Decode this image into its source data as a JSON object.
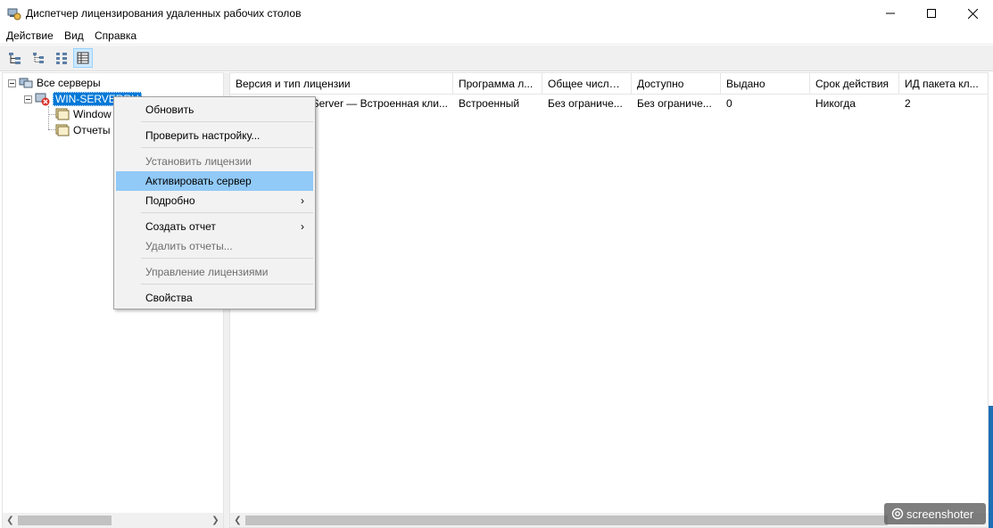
{
  "window": {
    "title": "Диспетчер лицензирования удаленных рабочих столов",
    "icon": "license-manager-icon"
  },
  "menu": {
    "items": [
      "Действие",
      "Вид",
      "Справка"
    ]
  },
  "toolbar": {
    "buttons": [
      "tree-view-icon",
      "list-view-icon",
      "details-view-icon",
      "report-view-icon"
    ]
  },
  "tree": {
    "root": "Все серверы",
    "server": "WIN-SERVERRU",
    "children": [
      "Window",
      "Отчеты"
    ]
  },
  "list": {
    "columns": [
      "Версия и тип лицензии",
      "Программа л...",
      "Общее число ...",
      "Доступно",
      "Выдано",
      "Срок действия",
      "ИД пакета кл..."
    ],
    "rows": [
      [
        "...) Server — Встроенная кли...",
        "Встроенный",
        "Без ограниче...",
        "Без ограниче...",
        "0",
        "Никогда",
        "2"
      ]
    ]
  },
  "context_menu": {
    "items": [
      {
        "label": "Обновить",
        "state": "enabled"
      },
      {
        "label": "Проверить настройку...",
        "state": "enabled"
      },
      {
        "label": "Установить лицензии",
        "state": "disabled"
      },
      {
        "label": "Активировать сервер",
        "state": "highlighted"
      },
      {
        "label": "Подробно",
        "state": "enabled",
        "submenu": true
      },
      {
        "label": "Создать отчет",
        "state": "enabled",
        "submenu": true
      },
      {
        "label": "Удалить отчеты...",
        "state": "disabled"
      },
      {
        "label": "Управление лицензиями",
        "state": "disabled"
      },
      {
        "label": "Свойства",
        "state": "enabled"
      }
    ]
  },
  "watermark": "screenshoter",
  "colors": {
    "selection": "#0078d7",
    "menu_highlight": "#91c9f7",
    "menu_background": "#f2f2f2",
    "disabled_text": "#6d6d6d"
  }
}
